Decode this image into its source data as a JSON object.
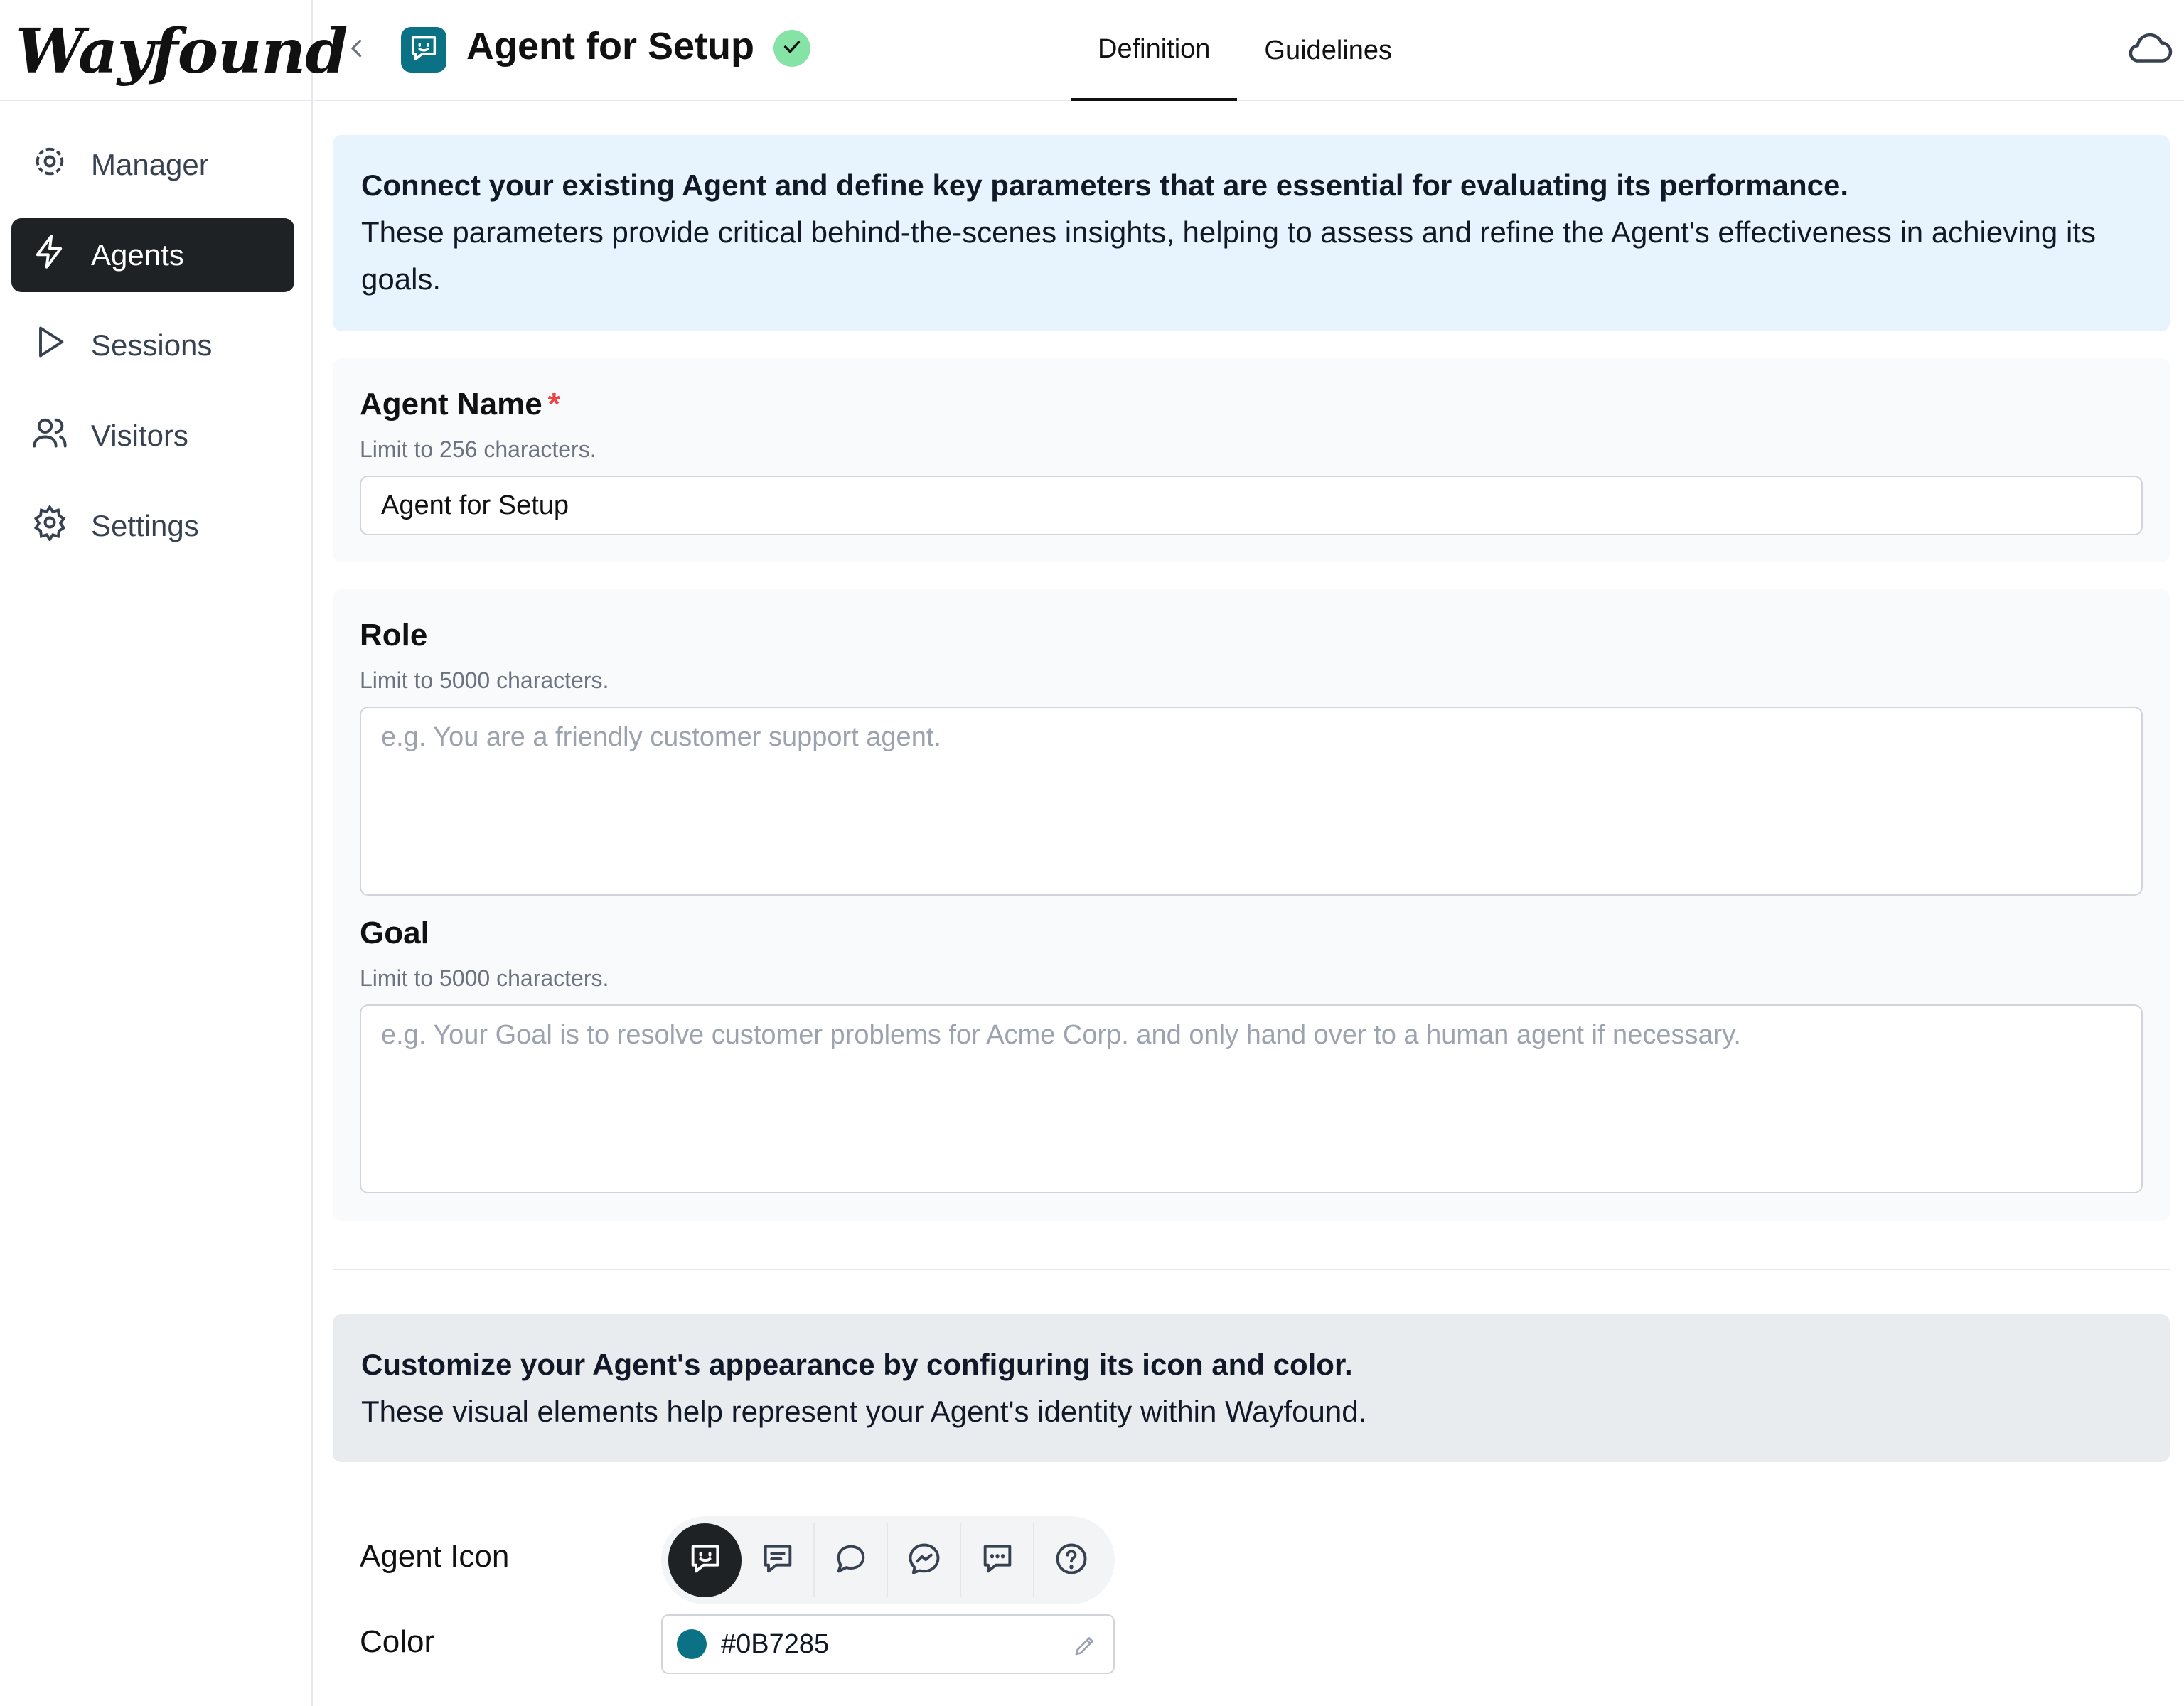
{
  "app": {
    "logo": "Wayfound"
  },
  "sidebar": {
    "items": [
      {
        "label": "Manager",
        "icon": "manager-icon",
        "active": false
      },
      {
        "label": "Agents",
        "icon": "bolt-icon",
        "active": true
      },
      {
        "label": "Sessions",
        "icon": "play-icon",
        "active": false
      },
      {
        "label": "Visitors",
        "icon": "users-icon",
        "active": false
      },
      {
        "label": "Settings",
        "icon": "gear-icon",
        "active": false
      }
    ]
  },
  "header": {
    "agent_name": "Agent for Setup",
    "tabs": [
      {
        "label": "Definition",
        "active": true
      },
      {
        "label": "Guidelines",
        "active": false
      }
    ]
  },
  "intro": {
    "title": "Connect your existing Agent and define key parameters that are essential for evaluating its performance.",
    "body": "These parameters provide critical behind-the-scenes insights, helping to assess and refine the Agent's effectiveness in achieving its goals."
  },
  "fields": {
    "agent_name": {
      "label": "Agent Name",
      "required_mark": "*",
      "hint": "Limit to 256 characters.",
      "value": "Agent for Setup"
    },
    "role": {
      "label": "Role",
      "hint": "Limit to 5000 characters.",
      "placeholder": "e.g. You are a friendly customer support agent."
    },
    "goal": {
      "label": "Goal",
      "hint": "Limit to 5000 characters.",
      "placeholder": "e.g. Your Goal is to resolve customer problems for Acme Corp. and only hand over to a human agent if necessary."
    }
  },
  "appearance": {
    "title": "Customize your Agent's appearance by configuring its icon and color.",
    "body": "These visual elements help represent your Agent's identity within Wayfound.",
    "icon_label": "Agent Icon",
    "icons": [
      "chat-smile-icon",
      "chat-lines-icon",
      "chat-bubble-icon",
      "messenger-icon",
      "chat-dots-icon",
      "help-circle-icon"
    ],
    "selected_icon": "chat-smile-icon",
    "color_label": "Color",
    "color_value": "#0B7285"
  },
  "colors": {
    "accent": "#0B7285",
    "active_nav": "#1F2224",
    "info_bg": "#E8F4FD",
    "check": "#86E3A6"
  }
}
